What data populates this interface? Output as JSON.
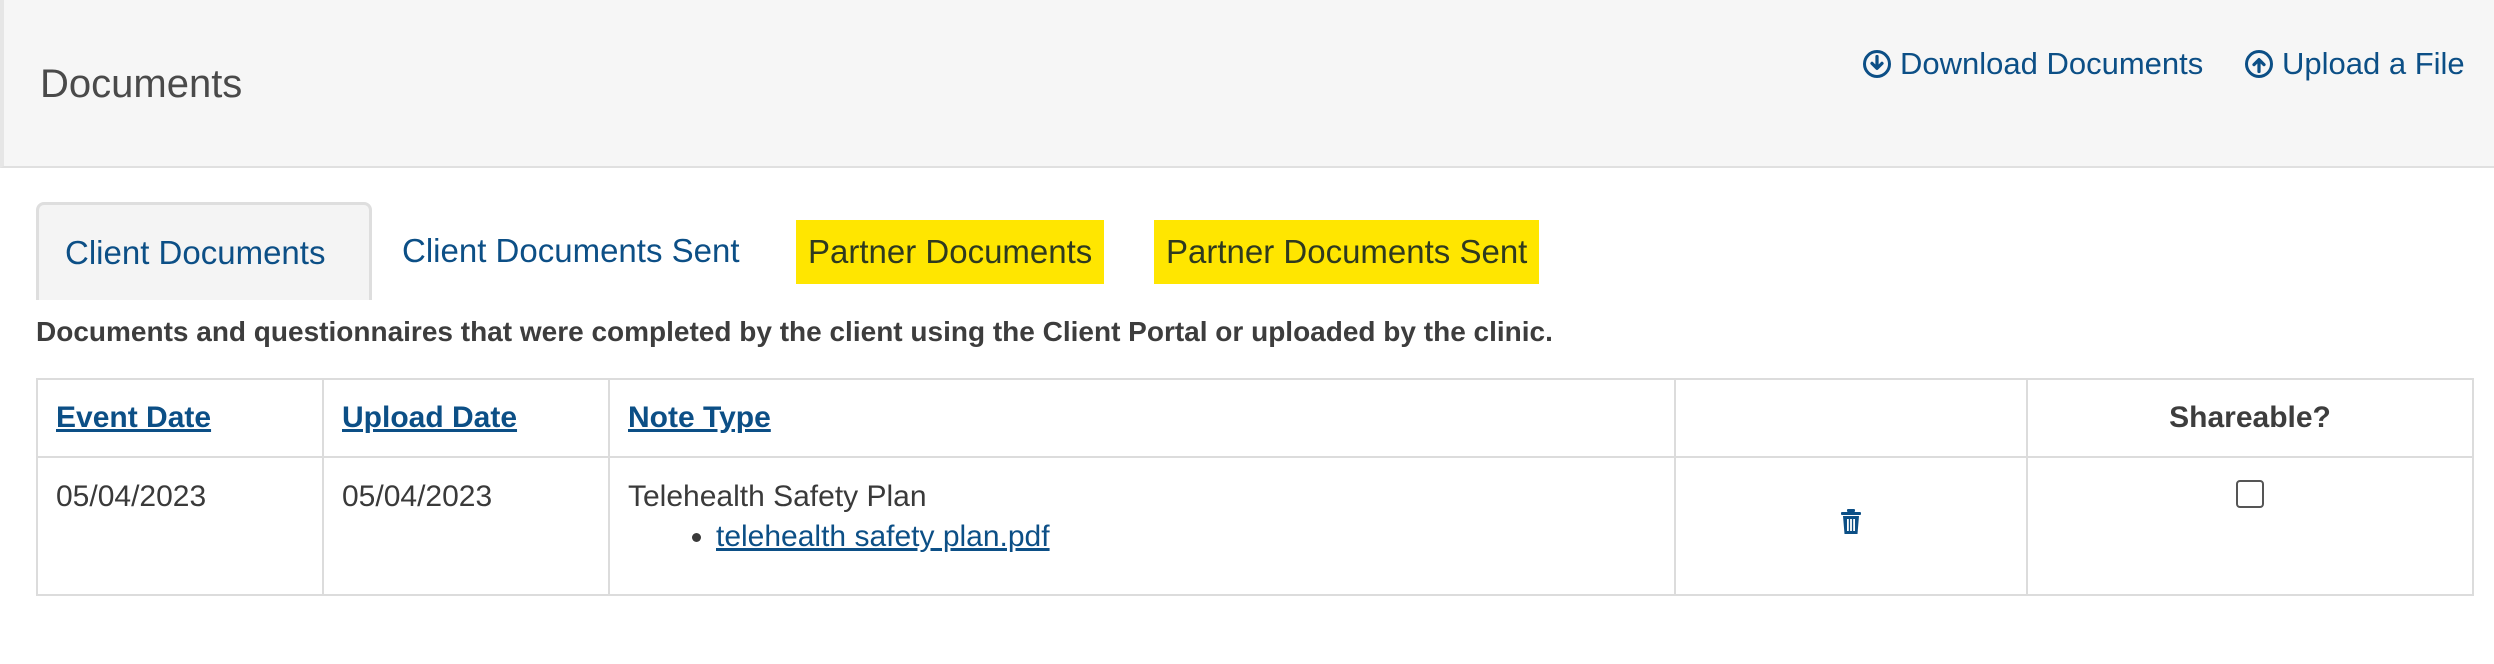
{
  "header": {
    "title": "Documents",
    "download_label": "Download Documents",
    "upload_label": "Upload a File"
  },
  "tabs": [
    {
      "label": "Client Documents",
      "active": true
    },
    {
      "label": "Client Documents Sent",
      "active": false
    },
    {
      "label": "Partner Documents",
      "active": false,
      "highlighted": true
    },
    {
      "label": "Partner Documents Sent",
      "active": false,
      "highlighted": true
    }
  ],
  "description": "Documents and questionnaires that were completed by the client using the Client Portal or uploaded by the clinic.",
  "table": {
    "columns": [
      "Event Date",
      "Upload Date",
      "Note Type",
      "",
      "Shareable?"
    ],
    "rows": [
      {
        "event_date": "05/04/2023",
        "upload_date": "05/04/2023",
        "note_type": "Telehealth Safety Plan",
        "file": "telehealth safety plan.pdf",
        "action_icon": "trash-icon",
        "shareable": false
      }
    ]
  },
  "colors": {
    "link": "#0c4f86",
    "highlight": "#ffe600",
    "header_bg": "#f6f6f6"
  }
}
